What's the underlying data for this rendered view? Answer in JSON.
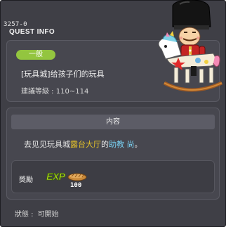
{
  "window": {
    "quest_id": "3257-0",
    "title": "QUEST INFO"
  },
  "quest": {
    "category": "一般",
    "name": "[玩具城]给孩子们的玩具",
    "recommended_level_label": "建議等級 :",
    "recommended_level_value": "110~114"
  },
  "content": {
    "header": "内容",
    "text_before": "去见见玩具城",
    "place": "露台大厅",
    "text_middle": "的",
    "npc": "助教 尚",
    "text_after": "。"
  },
  "reward": {
    "label": "獎勵",
    "exp_label": "EXP",
    "amount": "100",
    "item_icon": "bread-icon"
  },
  "status": {
    "label": "狀態 :",
    "value": "可開始"
  },
  "colors": {
    "window_bg": "#3f3f46",
    "badge": "#93c53f",
    "place_highlight": "#e6c32a",
    "npc_highlight": "#79d0f2",
    "exp": "#b6e21a"
  },
  "npc_portrait": "toy-soldier-on-rocking-horse-icon"
}
